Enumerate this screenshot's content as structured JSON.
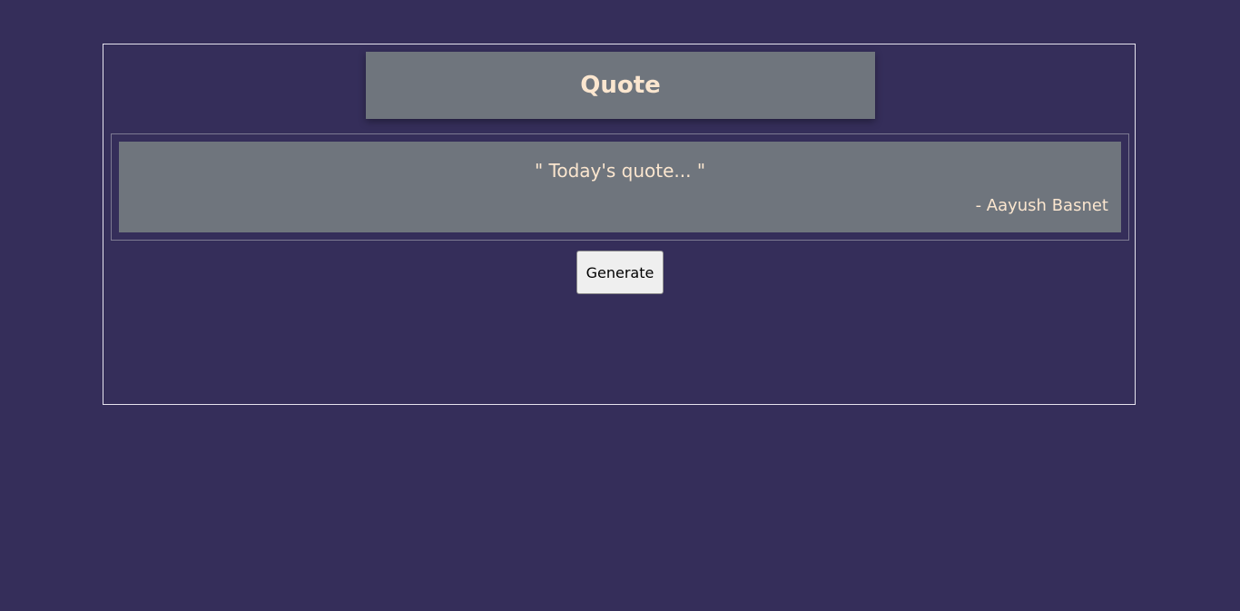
{
  "header": {
    "title": "Quote"
  },
  "quote": {
    "text": "\" Today's quote... \"",
    "author": "- Aayush Basnet"
  },
  "actions": {
    "generate_label": "Generate"
  },
  "colors": {
    "background": "#352e5a",
    "panel": "#6f757d",
    "text": "#fbe6cf"
  }
}
